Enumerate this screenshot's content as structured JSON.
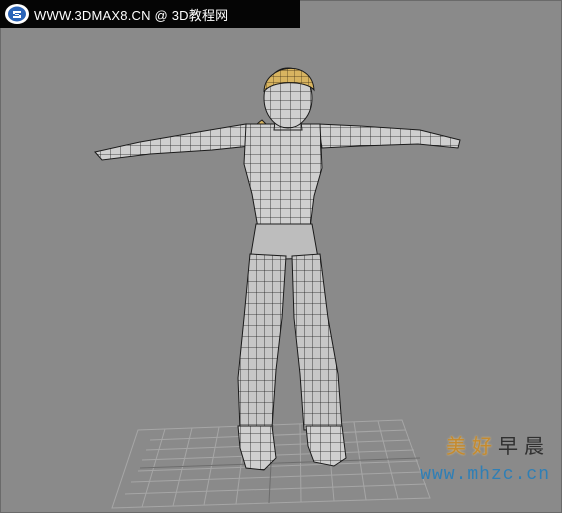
{
  "titlebar": {
    "logo_icon": "3dmax8-logo-icon",
    "text": "WWW.3DMAX8.CN @ 3D教程网"
  },
  "watermark": {
    "text_part1": "美好",
    "text_part2": "早晨",
    "url": "www.mhzc.cn"
  },
  "colors": {
    "background": "#8a8a8a",
    "wire": "#1a1a1a",
    "mesh_fill": "#cfcfcf",
    "hair": "#d8b460",
    "grid": "#a6a6a6",
    "titlebar_bg": "#050505"
  }
}
